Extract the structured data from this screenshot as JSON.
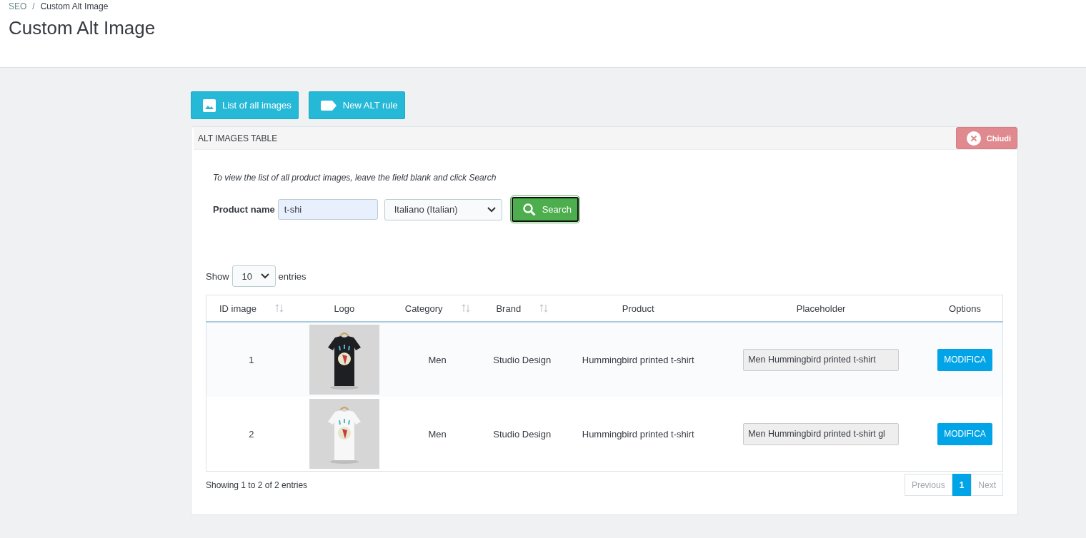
{
  "breadcrumb": [
    "SEO",
    "Custom Alt Image"
  ],
  "page_title": "Custom Alt Image",
  "breadcrumb_separator": "/",
  "toolbar": [
    {
      "label": "List of all images"
    },
    {
      "label": "New ALT rule"
    }
  ],
  "panel": {
    "title": "ALT IMAGES TABLE",
    "close_button": "Chiudi",
    "hint": "To view the list of all product images, leave the field blank and click Search",
    "search": {
      "label": "Product name",
      "value": "t-shi",
      "language": "Italiano (Italian)",
      "button": "Search"
    },
    "length": {
      "before": "Show",
      "value": "10",
      "after": "entries"
    },
    "table": {
      "columns": [
        {
          "label": "ID image",
          "sortable": true
        },
        {
          "label": "Logo",
          "sortable": false
        },
        {
          "label": "Category",
          "sortable": true
        },
        {
          "label": "Brand",
          "sortable": true
        },
        {
          "label": "Product",
          "sortable": false
        },
        {
          "label": "Placeholder",
          "sortable": false
        },
        {
          "label": "Options",
          "sortable": false
        }
      ],
      "rows": [
        {
          "id": "1",
          "category": "Men",
          "brand": "Studio Design",
          "product": "Hummingbird printed t-shirt",
          "value": "Men Hummingbird printed t-shirt",
          "action": "MODIFICA"
        },
        {
          "id": "2",
          "category": "Men",
          "brand": "Studio Design",
          "product": "Hummingbird printed t-shirt",
          "value": "Men Hummingbird printed t-shirt gl",
          "action": "MODIFICA"
        }
      ]
    },
    "info": "Showing 1 to 2 of 2 entries",
    "pagination": [
      {
        "label": "Previous",
        "selected": false,
        "disabled": true
      },
      {
        "label": "1",
        "selected": true,
        "disabled": false
      },
      {
        "label": "Next",
        "selected": false,
        "disabled": true
      }
    ]
  }
}
